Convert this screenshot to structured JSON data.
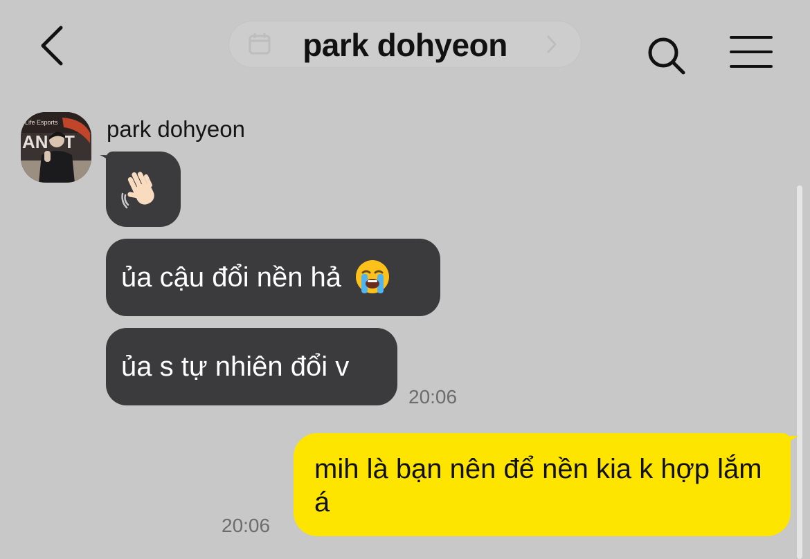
{
  "header": {
    "title": "park dohyeon",
    "back_icon": "chevron-left-icon",
    "search_icon": "search-icon",
    "menu_icon": "hamburger-menu-icon",
    "date_pill_icon": "calendar-icon"
  },
  "chat": {
    "sender_name": "park dohyeon",
    "messages": [
      {
        "from": "them",
        "emoji": "waving-hand-emoji"
      },
      {
        "from": "them",
        "text": "ủa cậu đổi nền hả",
        "emoji": "loudly-crying-face-emoji"
      },
      {
        "from": "them",
        "text": "ủa s tự nhiên đổi v",
        "time": "20:06"
      },
      {
        "from": "me",
        "text": "mih là bạn nên để nền kia k hợp lắm á",
        "time": "20:06"
      }
    ]
  },
  "colors": {
    "background": "#c8c8c8",
    "incoming_bubble": "#3b3b3d",
    "outgoing_bubble": "#fee500",
    "timestamp": "#6c6c6c"
  }
}
